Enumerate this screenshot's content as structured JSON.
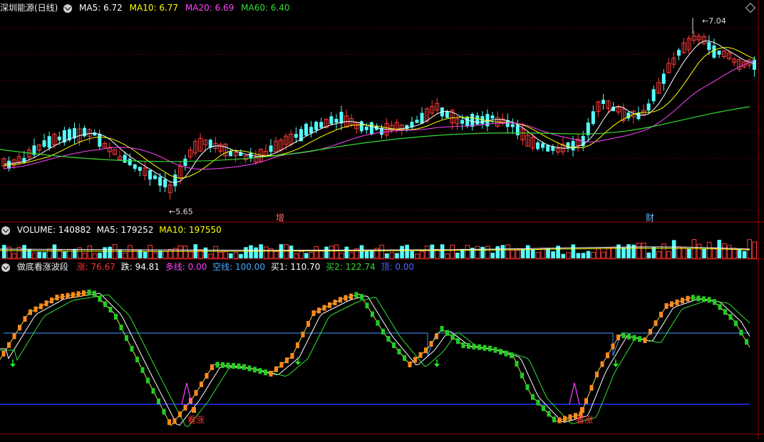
{
  "panels": {
    "price": {
      "title": "深圳能源(日线)",
      "ma_labels": [
        {
          "text": "MA5: 6.72",
          "color": "#ffffff"
        },
        {
          "text": "MA10: 6.77",
          "color": "#ffff00"
        },
        {
          "text": "MA20: 6.69",
          "color": "#ff44ff"
        },
        {
          "text": "MA60: 6.40",
          "color": "#33dd33"
        }
      ],
      "high_label": "7.04",
      "low_label": "5.65",
      "markers": [
        {
          "text": "增",
          "color": "#ff6666"
        },
        {
          "text": "财",
          "color": "#66bbff"
        }
      ]
    },
    "volume": {
      "labels": [
        {
          "text": "VOLUME: 140882",
          "color": "#ffffff"
        },
        {
          "text": "MA5: 179252",
          "color": "#ffffff"
        },
        {
          "text": "MA10: 197550",
          "color": "#ffff00"
        }
      ]
    },
    "indicator": {
      "title": "做底看涨波段",
      "labels": [
        {
          "text": "涨: 76.67",
          "color": "#ff3333"
        },
        {
          "text": "跌: 94.81",
          "color": "#ffffff"
        },
        {
          "text": "多线: 0.00",
          "color": "#ff44ff"
        },
        {
          "text": "空线: 100.00",
          "color": "#44aaff"
        },
        {
          "text": "买1: 110.70",
          "color": "#ffffff"
        },
        {
          "text": "买2: 122.74",
          "color": "#33dd33"
        },
        {
          "text": "顶: 0.00",
          "color": "#5566ff"
        }
      ],
      "signal_text": "看涨"
    }
  },
  "colors": {
    "up": "#ff3c3c",
    "down": "#54ffff",
    "grid": "#8b0000",
    "osc_up": "#ff8a1e",
    "osc_down": "#22cc22"
  }
}
